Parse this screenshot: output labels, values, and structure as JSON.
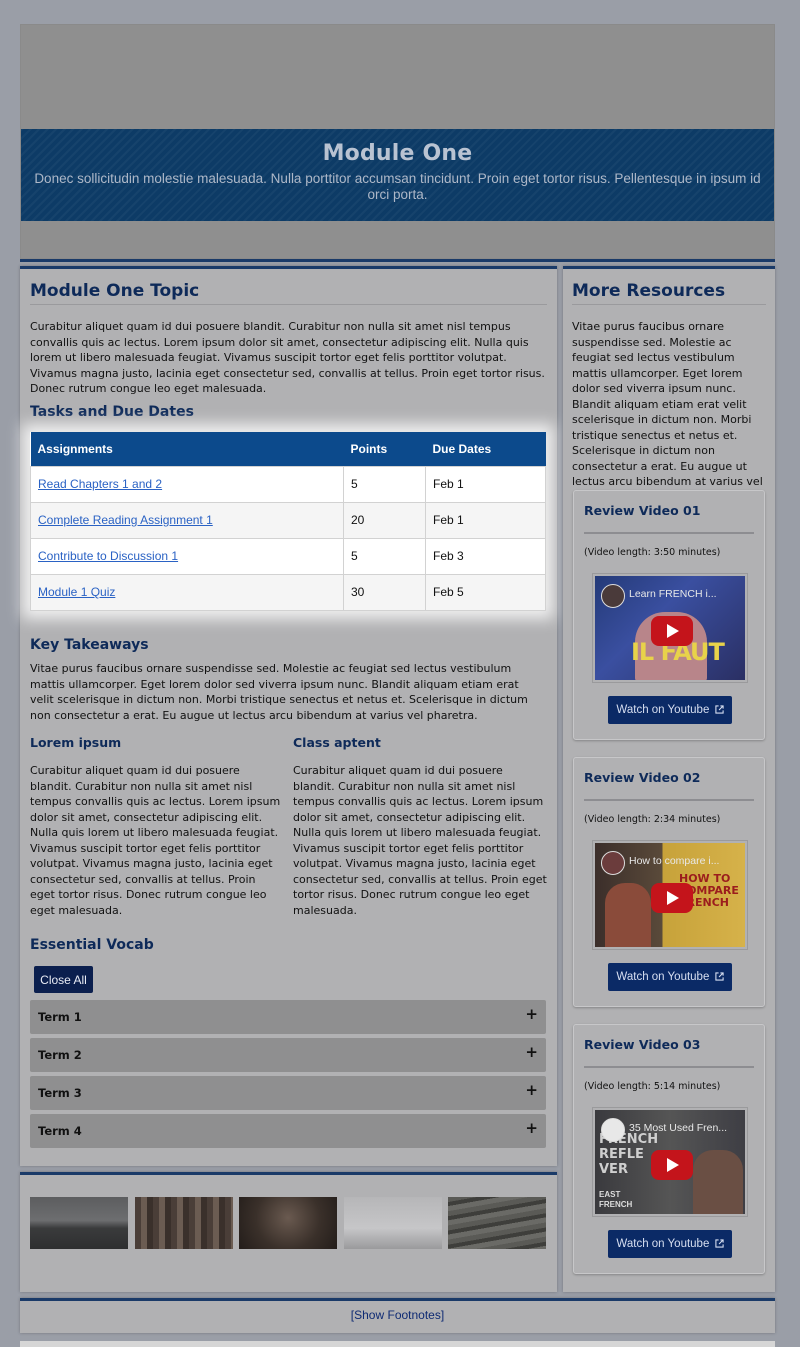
{
  "hero": {
    "title": "Module One",
    "subtitle": "Donec sollicitudin molestie malesuada. Nulla porttitor accumsan tincidunt. Proin eget tortor risus. Pellentesque in ipsum id orci porta."
  },
  "main": {
    "topic_heading": "Module One Topic",
    "topic_text": "Curabitur aliquet quam id dui posuere blandit. Curabitur non nulla sit amet nisl tempus convallis quis ac lectus. Lorem ipsum dolor sit amet, consectetur adipiscing elit. Nulla quis lorem ut libero malesuada feugiat. Vivamus suscipit tortor eget felis porttitor volutpat. Vivamus magna justo, lacinia eget consectetur sed, convallis at tellus. Proin eget tortor risus. Donec rutrum congue leo eget malesuada.",
    "tasks_heading": "Tasks and Due Dates",
    "table": {
      "headers": [
        "Assignments",
        "Points",
        "Due Dates"
      ],
      "rows": [
        {
          "assignment": "Read Chapters 1 and 2",
          "points": "5",
          "due": "Feb 1"
        },
        {
          "assignment": "Complete Reading Assignment 1",
          "points": "20",
          "due": "Feb 1"
        },
        {
          "assignment": "Contribute to Discussion 1",
          "points": "5",
          "due": "Feb 3"
        },
        {
          "assignment": "Module 1 Quiz",
          "points": "30",
          "due": "Feb 5"
        }
      ]
    },
    "takeaways_heading": "Key Takeaways",
    "takeaways_text": "Vitae purus faucibus ornare suspendisse sed. Molestie ac feugiat sed lectus vestibulum mattis ullamcorper. Eget lorem dolor sed viverra ipsum nunc. Blandit aliquam etiam erat velit scelerisque in dictum non. Morbi tristique senectus et netus et. Scelerisque in dictum non consectetur a erat. Eu augue ut lectus arcu bibendum at varius vel pharetra.",
    "col_left": {
      "heading": "Lorem ipsum",
      "text": "Curabitur aliquet quam id dui posuere blandit. Curabitur non nulla sit amet nisl tempus convallis quis ac lectus. Lorem ipsum dolor sit amet, consectetur adipiscing elit. Nulla quis lorem ut libero malesuada feugiat. Vivamus suscipit tortor eget felis porttitor volutpat. Vivamus magna justo, lacinia eget consectetur sed, convallis at tellus. Proin eget tortor risus. Donec rutrum congue leo eget malesuada."
    },
    "col_right": {
      "heading": "Class aptent",
      "text": "Curabitur aliquet quam id dui posuere blandit. Curabitur non nulla sit amet nisl tempus convallis quis ac lectus. Lorem ipsum dolor sit amet, consectetur adipiscing elit. Nulla quis lorem ut libero malesuada feugiat. Vivamus suscipit tortor eget felis porttitor volutpat. Vivamus magna justo, lacinia eget consectetur sed, convallis at tellus. Proin eget tortor risus. Donec rutrum congue leo eget malesuada."
    },
    "vocab_heading": "Essential Vocab",
    "close_all_label": "Close All",
    "terms": [
      "Term 1",
      "Term 2",
      "Term 3",
      "Term 4"
    ],
    "expand_glyph": "+"
  },
  "sidebar": {
    "heading": "More Resources",
    "text": "Vitae purus faucibus ornare suspendisse sed. Molestie ac feugiat sed lectus vestibulum mattis ullamcorper. Eget lorem dolor sed viverra ipsum nunc. Blandit aliquam etiam erat velit scelerisque in dictum non. Morbi tristique senectus et netus et. Scelerisque in dictum non consectetur a erat. Eu augue ut lectus arcu bibendum at varius vel pharetra.",
    "videos": [
      {
        "title": "Review Video 01",
        "length": "(Video length: 3:50 minutes)",
        "thumb_title": "Learn FRENCH i...",
        "button": "Watch on Youtube"
      },
      {
        "title": "Review Video 02",
        "length": "(Video length: 2:34 minutes)",
        "thumb_title": "How to compare i...",
        "button": "Watch on Youtube"
      },
      {
        "title": "Review Video 03",
        "length": "(Video length: 5:14 minutes)",
        "thumb_title": "35 Most Used Fren...",
        "button": "Watch on Youtube"
      }
    ]
  },
  "footer": {
    "footnotes_link": "[Show Footnotes]"
  },
  "colors": {
    "brand_dark": "#0e2a59",
    "table_header": "#0c4a8c",
    "button": "#0b2a66",
    "link": "#2a62c4"
  },
  "icons": [
    "external-link-icon",
    "play-icon",
    "plus-icon"
  ]
}
